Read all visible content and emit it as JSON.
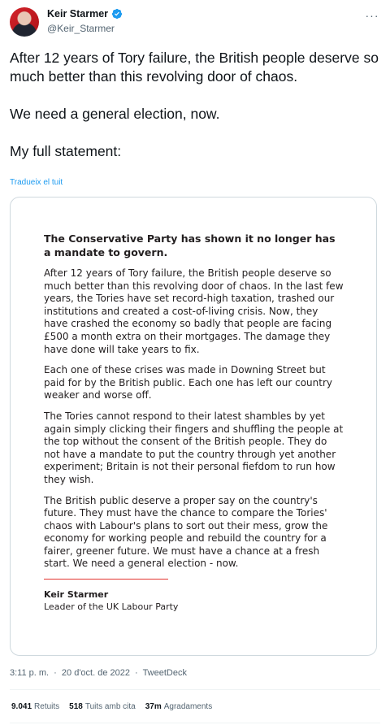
{
  "author": {
    "name": "Keir Starmer",
    "handle": "@Keir_Starmer",
    "verified_badge_color": "#1d9bf0"
  },
  "tweet": {
    "text": "After 12 years of Tory failure, the British people deserve so much better than this revolving door of chaos.\n\nWe need a general election, now.\n\nMy full statement:",
    "translate_label": "Tradueix el tuit"
  },
  "statement": {
    "heading": "The Conservative Party has shown it no longer has a mandate to govern.",
    "paragraphs": [
      "After 12 years of Tory failure, the British people deserve so much better than this revolving door of chaos. In the last few years, the Tories have set record-high taxation, trashed our institutions and created a cost-of-living crisis. Now, they have crashed the economy so badly that people are facing £500 a month extra on their mortgages. The damage they have done will take years to fix.",
      "Each one of these crises was made in Downing Street but paid for by the British public. Each one has left our country weaker and worse off.",
      "The Tories cannot respond to their latest shambles by yet again simply clicking their fingers and shuffling the people at the top without the consent of the British people. They do not have a mandate to put the country through yet another experiment; Britain is not their personal fiefdom to run how they wish.",
      "The British public deserve a proper say on the country's future. They must have the chance to compare the Tories' chaos with Labour's plans to sort out their mess, grow the economy for working people and rebuild the country for a fairer, greener future. We must have a chance at a fresh start. We need a general election - now."
    ],
    "signature_name": "Keir Starmer",
    "signature_title": "Leader of the UK Labour Party",
    "accent_color": "#e3342f"
  },
  "meta": {
    "time": "3:11 p. m.",
    "separator": "·",
    "date": "20 d'oct. de 2022",
    "client": "TweetDeck"
  },
  "stats": {
    "retweets_count": "9.041",
    "retweets_label": "Retuits",
    "quotes_count": "518",
    "quotes_label": "Tuits amb cita",
    "likes_count": "37m",
    "likes_label": "Agradaments"
  }
}
